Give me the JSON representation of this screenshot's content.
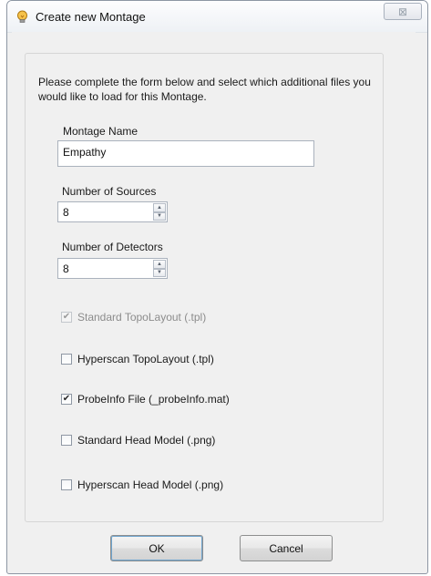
{
  "window": {
    "title": "Create new Montage",
    "close_symbol": "⊠"
  },
  "form": {
    "instruction": "Please complete the form below and select which additional files you would like to load for this Montage.",
    "montage_name_label": "Montage Name",
    "montage_name_value": "Empathy",
    "sources_label": "Number of Sources",
    "sources_value": "8",
    "detectors_label": "Number of Detectors",
    "detectors_value": "8"
  },
  "options": [
    {
      "label": "Standard TopoLayout (.tpl)",
      "checked": true,
      "enabled": false
    },
    {
      "label": "Hyperscan TopoLayout (.tpl)",
      "checked": false,
      "enabled": true
    },
    {
      "label": "ProbeInfo File (_probeInfo.mat)",
      "checked": true,
      "enabled": true
    },
    {
      "label": "Standard Head Model (.png)",
      "checked": false,
      "enabled": true
    },
    {
      "label": "Hyperscan Head Model (.png)",
      "checked": false,
      "enabled": true
    }
  ],
  "buttons": {
    "ok_label": "OK",
    "cancel_label": "Cancel"
  },
  "icons": {
    "app": "lightbulb-icon",
    "close": "close-icon",
    "spin_up": "▲",
    "spin_down": "▼",
    "check": "✔"
  }
}
